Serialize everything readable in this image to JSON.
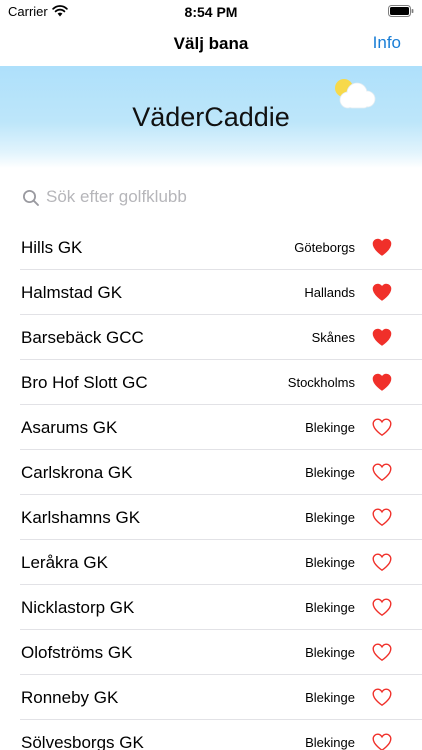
{
  "status_bar": {
    "carrier": "Carrier",
    "time": "8:54 PM"
  },
  "nav": {
    "title": "Välj bana",
    "info_label": "Info"
  },
  "banner": {
    "title": "VäderCaddie"
  },
  "search": {
    "placeholder": "Sök efter golfklubb",
    "value": ""
  },
  "colors": {
    "accent": "#1a7ed6",
    "heart": "#f0302a",
    "banner_sky": "#aee0fb"
  },
  "clubs": [
    {
      "name": "Hills GK",
      "region": "Göteborgs",
      "favorite": true
    },
    {
      "name": "Halmstad GK",
      "region": "Hallands",
      "favorite": true
    },
    {
      "name": "Barsebäck GCC",
      "region": "Skånes",
      "favorite": true
    },
    {
      "name": "Bro Hof Slott GC",
      "region": "Stockholms",
      "favorite": true
    },
    {
      "name": "Asarums GK",
      "region": "Blekinge",
      "favorite": false
    },
    {
      "name": "Carlskrona GK",
      "region": "Blekinge",
      "favorite": false
    },
    {
      "name": "Karlshamns GK",
      "region": "Blekinge",
      "favorite": false
    },
    {
      "name": "Leråkra GK",
      "region": "Blekinge",
      "favorite": false
    },
    {
      "name": "Nicklastorp GK",
      "region": "Blekinge",
      "favorite": false
    },
    {
      "name": "Olofströms GK",
      "region": "Blekinge",
      "favorite": false
    },
    {
      "name": "Ronneby GK",
      "region": "Blekinge",
      "favorite": false
    },
    {
      "name": "Sölvesborgs GK",
      "region": "Blekinge",
      "favorite": false
    }
  ]
}
